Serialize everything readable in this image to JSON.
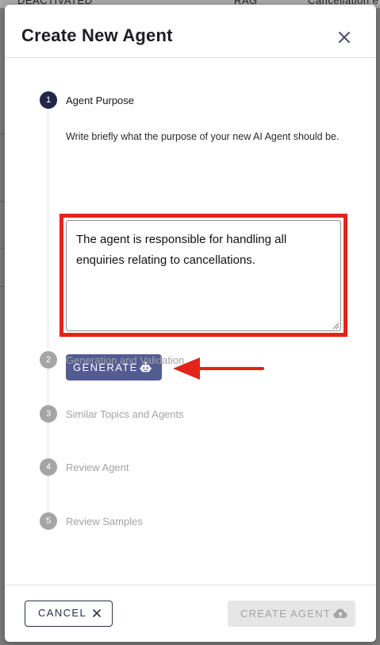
{
  "background": {
    "toolbar_items": [
      "DEACTIVATED",
      "RAG",
      "Cancellation e"
    ]
  },
  "modal": {
    "title": "Create New Agent",
    "close_icon": "close-icon",
    "steps": [
      {
        "number": "1",
        "label": "Agent Purpose",
        "state": "active",
        "description": "Write briefly what the purpose of your new AI Agent should be.",
        "textarea_value": "The agent is responsible for handling all enquiries relating to cancellations.",
        "generate_label": "GENERATE",
        "generate_icon": "robot-icon"
      },
      {
        "number": "2",
        "label": "Generation and Validation",
        "state": "inactive"
      },
      {
        "number": "3",
        "label": "Similar Topics and Agents",
        "state": "inactive"
      },
      {
        "number": "4",
        "label": "Review Agent",
        "state": "inactive"
      },
      {
        "number": "5",
        "label": "Review Samples",
        "state": "inactive"
      }
    ],
    "footer": {
      "cancel_label": "CANCEL",
      "cancel_icon": "close-icon",
      "create_label": "CREATE AGENT",
      "create_icon": "cloud-upload-icon",
      "create_disabled": true
    }
  },
  "annotation": {
    "highlight_color": "#e3241b",
    "arrow_color": "#e3241b"
  },
  "colors": {
    "active_step": "#22274a",
    "inactive_step": "#a5a5a5",
    "generate_button": "#535b93",
    "disabled_button": "#e6e6e6"
  }
}
